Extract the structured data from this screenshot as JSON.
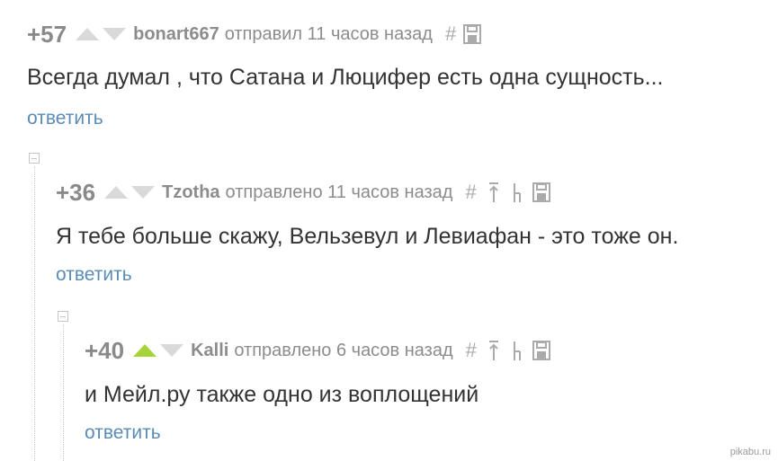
{
  "comments": [
    {
      "rating": "+57",
      "user": "bonart667",
      "meta": "отправил 11 часов назад",
      "text": "Всегда думал , что Сатана и Люцифер есть одна сущность...",
      "reply": "ответить",
      "upvoted": false
    },
    {
      "rating": "+36",
      "user": "Tzotha",
      "meta": "отправлено 11 часов назад",
      "text": "Я тебе больше скажу, Вельзевул и Левиафан - это тоже он.",
      "reply": "ответить",
      "upvoted": false
    },
    {
      "rating": "+40",
      "user": "Kalli",
      "meta": "отправлено 6 часов назад",
      "text": "и Мейл.ру также одно из воплощений",
      "reply": "ответить",
      "upvoted": true
    }
  ],
  "icons": {
    "link": "hash-icon",
    "parent": "arrow-up-icon",
    "thread": "branch-icon",
    "save": "floppy-disk-icon"
  },
  "colors": {
    "upvote_active": "#a6d23a",
    "vote_inactive": "#d9d9d9",
    "reply_link": "#5a8cb7"
  },
  "watermark": "pikabu.ru"
}
